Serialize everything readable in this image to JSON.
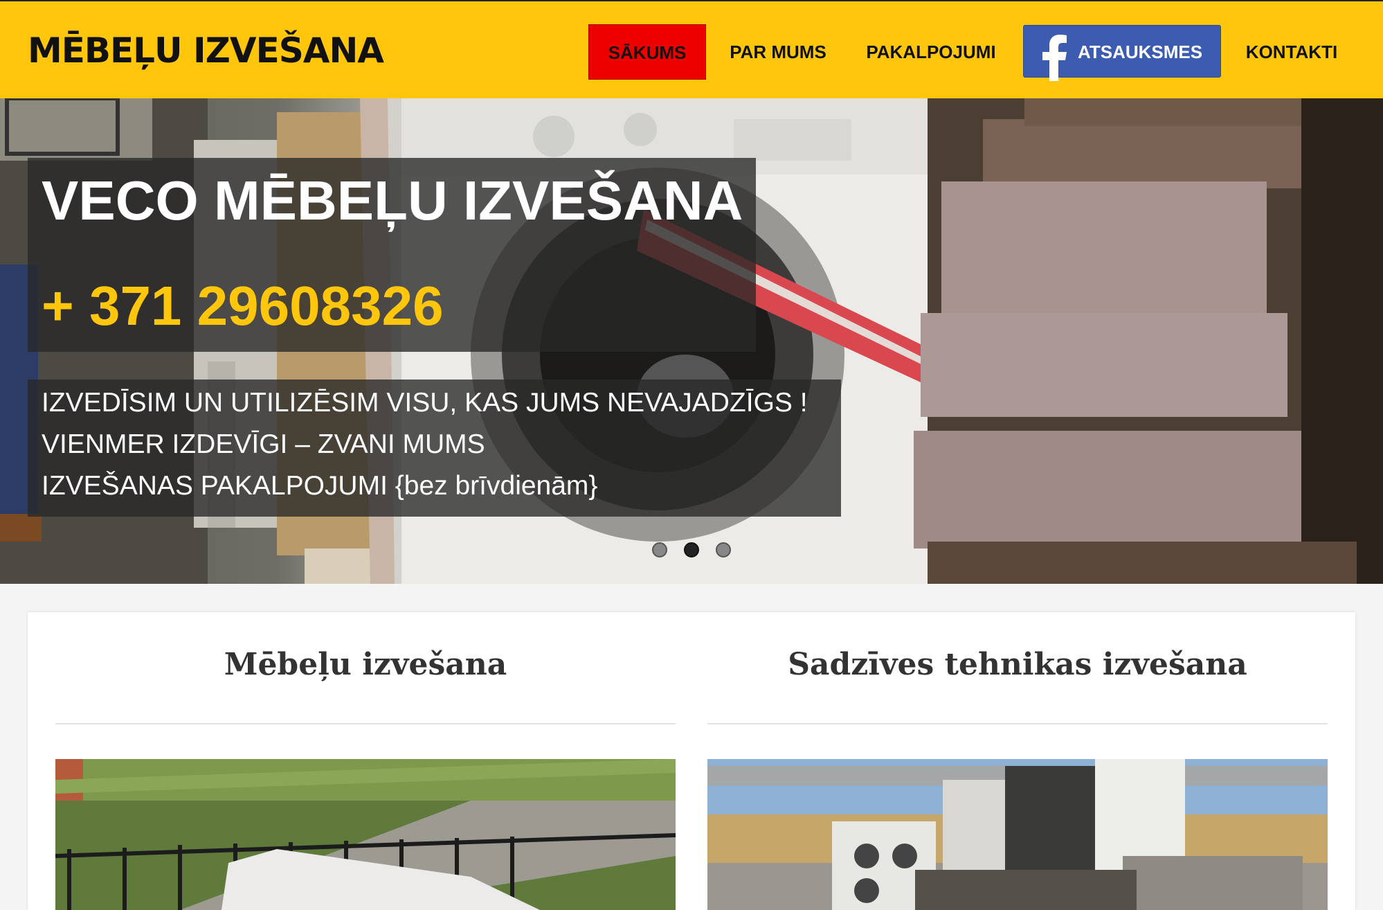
{
  "header": {
    "logo": "MĒBEĻU IZVEŠANA",
    "nav": {
      "home": "SĀKUMS",
      "about": "PAR MUMS",
      "services": "PAKALPOJUMI",
      "reviews": "ATSAUKSMES",
      "contacts": "KONTAKTI"
    }
  },
  "hero": {
    "title": "VECO MĒBEĻU IZVEŠANA",
    "phone": "+ 371 29608326",
    "lines": [
      "IZVEDĪSIM UN UTILIZĒSIM VISU, KAS JUMS NEVAJADZĪGS !",
      "VIENMER IZDEVĪGI – ZVANI MUMS",
      "IZVEŠANAS PAKALPOJUMI {bez brīvdienām}"
    ],
    "slides_total": 3,
    "active_slide": 2
  },
  "sections": [
    {
      "title": "Mēbeļu izvešana"
    },
    {
      "title": "Sadzīves tehnikas izvešana"
    }
  ],
  "colors": {
    "header_bg": "#ffc60b",
    "active_nav": "#ee0000",
    "facebook": "#3b5cb0",
    "phone_accent": "#ffc60b"
  }
}
